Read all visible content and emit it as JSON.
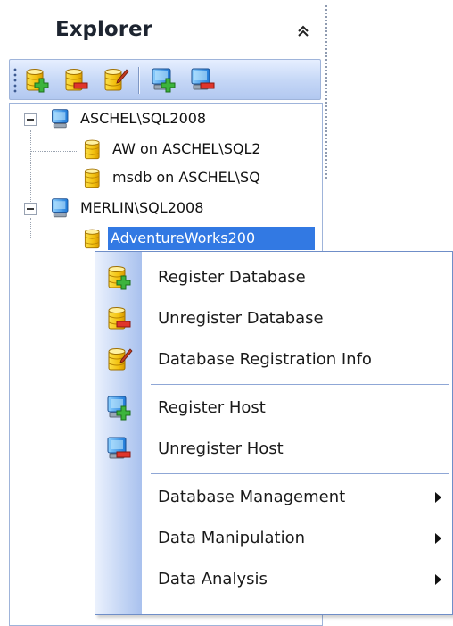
{
  "explorer": {
    "title": "Explorer",
    "collapse_glyph": "«"
  },
  "toolbar": {
    "buttons": [
      {
        "name": "register-database",
        "icon": "db-add-icon"
      },
      {
        "name": "unregister-database",
        "icon": "db-remove-icon"
      },
      {
        "name": "database-registration-info",
        "icon": "db-edit-icon"
      },
      {
        "name": "register-host",
        "icon": "host-add-icon"
      },
      {
        "name": "unregister-host",
        "icon": "host-remove-icon"
      }
    ]
  },
  "tree": {
    "hosts": [
      {
        "label": "ASCHEL\\SQL2008",
        "expanded": true,
        "databases": [
          {
            "label": "AW on ASCHEL\\SQL2"
          },
          {
            "label": "msdb on ASCHEL\\SQ"
          }
        ]
      },
      {
        "label": "MERLIN\\SQL2008",
        "expanded": true,
        "databases": [
          {
            "label": "AdventureWorks200",
            "selected": true
          }
        ]
      }
    ]
  },
  "context_menu": {
    "items": [
      {
        "label": "Register Database",
        "icon": "db-add-icon",
        "submenu": false
      },
      {
        "label": "Unregister Database",
        "icon": "db-remove-icon",
        "submenu": false
      },
      {
        "label": "Database Registration Info",
        "icon": "db-edit-icon",
        "submenu": false
      },
      {
        "label": "Register Host",
        "icon": "host-add-icon",
        "submenu": false
      },
      {
        "label": "Unregister Host",
        "icon": "host-remove-icon",
        "submenu": false
      },
      {
        "label": "Database Management",
        "submenu": true
      },
      {
        "label": "Data Manipulation",
        "submenu": true
      },
      {
        "label": "Data Analysis",
        "submenu": true
      }
    ]
  },
  "colors": {
    "selection": "#3279e3",
    "menu_border": "#6f8ec8",
    "toolbar_blue": "#c4d6f6",
    "db_yellow": "#f5c518",
    "add_green": "#3cb43c",
    "remove_red": "#e0352b"
  }
}
